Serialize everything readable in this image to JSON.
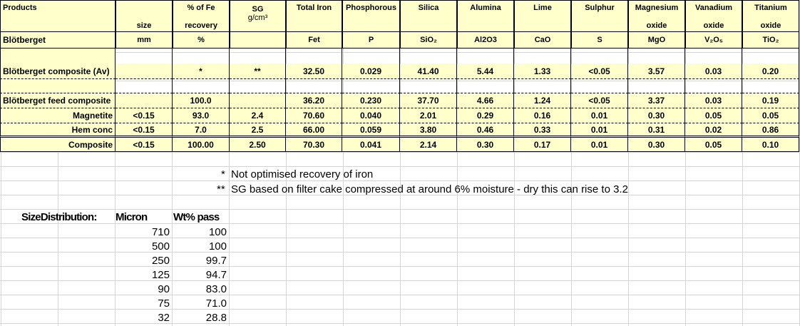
{
  "header": {
    "products": "Products",
    "size": "size",
    "fe_recovery_1": "% of Fe",
    "fe_recovery_2": "recovery",
    "sg_1": "SG",
    "sg_2": "g/cm³",
    "total_iron": "Total Iron",
    "phosphorous": "Phosphorous",
    "silica": "Silica",
    "alumina": "Alumina",
    "lime": "Lime",
    "sulphur": "Sulphur",
    "magnesium_1": "Magnesium",
    "magnesium_2": "oxide",
    "vanadium_1": "Vanadium",
    "vanadium_2": "oxide",
    "titanium_1": "Titanium",
    "titanium_2": "oxide"
  },
  "units": {
    "name": "Blötberget",
    "size": "mm",
    "recovery": "%",
    "sg": "",
    "fe": "Fet",
    "p": "P",
    "si": "SiO₂",
    "al": "Al2O3",
    "ca": "CaO",
    "s": "S",
    "mg": "MgO",
    "v": "V₂O₅",
    "ti": "TiO₂"
  },
  "rows": {
    "composite_av": {
      "name": "Blötberget composite (Av)",
      "size": "",
      "recovery": "*",
      "sg": "**",
      "fe": "32.50",
      "p": "0.029",
      "si": "41.40",
      "al": "5.44",
      "ca": "1.33",
      "s": "<0.05",
      "mg": "3.57",
      "v": "0.03",
      "ti": "0.20"
    },
    "feed": {
      "name": "Blötberget feed composite",
      "size": "",
      "recovery": "100.0",
      "sg": "",
      "fe": "36.20",
      "p": "0.230",
      "si": "37.70",
      "al": "4.66",
      "ca": "1.24",
      "s": "<0.05",
      "mg": "3.37",
      "v": "0.03",
      "ti": "0.19"
    },
    "magnetite": {
      "name": "Magnetite",
      "size": "<0.15",
      "recovery": "93.0",
      "sg": "2.4",
      "fe": "70.60",
      "p": "0.040",
      "si": "2.01",
      "al": "0.29",
      "ca": "0.16",
      "s": "0.01",
      "mg": "0.30",
      "v": "0.05",
      "ti": "0.05"
    },
    "hem": {
      "name": "Hem conc",
      "size": "<0.15",
      "recovery": "7.0",
      "sg": "2.5",
      "fe": "66.00",
      "p": "0.059",
      "si": "3.80",
      "al": "0.46",
      "ca": "0.33",
      "s": "0.01",
      "mg": "0.31",
      "v": "0.02",
      "ti": "0.86"
    },
    "composite": {
      "name": "Composite",
      "size": "<0.15",
      "recovery": "100.00",
      "sg": "2.50",
      "fe": "70.30",
      "p": "0.041",
      "si": "2.14",
      "al": "0.30",
      "ca": "0.17",
      "s": "0.01",
      "mg": "0.30",
      "v": "0.05",
      "ti": "0.10"
    }
  },
  "notes": {
    "n1_mark": "*",
    "n1_text": "Not optimised recovery of iron",
    "n2_mark": "**",
    "n2_text": "SG based on filter cake compressed at around 6% moisture - dry this can rise to 3.2"
  },
  "size_distribution": {
    "label": "SizeDistribution:",
    "col_micron": "Micron",
    "col_pass": "Wt% pass",
    "rows": [
      {
        "micron": "710",
        "pass": "100"
      },
      {
        "micron": "500",
        "pass": "100"
      },
      {
        "micron": "250",
        "pass": "99.7"
      },
      {
        "micron": "125",
        "pass": "94.7"
      },
      {
        "micron": "90",
        "pass": "83.0"
      },
      {
        "micron": "75",
        "pass": "71.0"
      },
      {
        "micron": "32",
        "pass": "28.8"
      }
    ]
  },
  "colors": {
    "cell_fill": "#ffffcc",
    "gridline": "#d4d4d4"
  }
}
